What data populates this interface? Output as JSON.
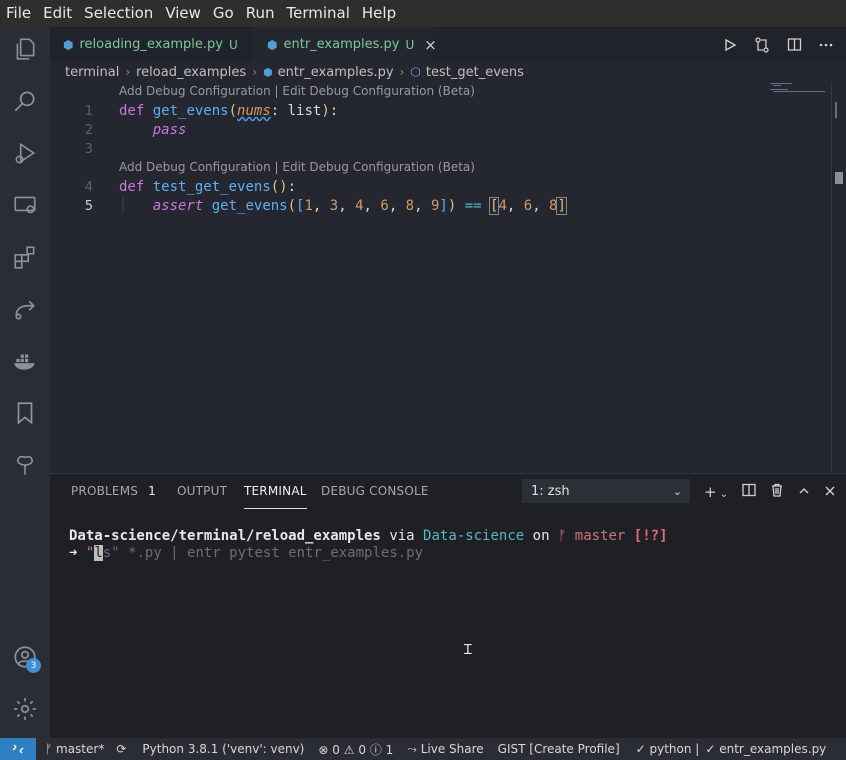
{
  "menu": [
    "File",
    "Edit",
    "Selection",
    "View",
    "Go",
    "Run",
    "Terminal",
    "Help"
  ],
  "activity_badge": "3",
  "tabs": [
    {
      "name": "reloading_example.py",
      "status": "U"
    },
    {
      "name": "entr_examples.py",
      "status": "U",
      "close": "×"
    }
  ],
  "breadcrumb": [
    "terminal",
    "reload_examples",
    "entr_examples.py",
    "test_get_evens"
  ],
  "codelens": "Add Debug Configuration | Edit Debug Configuration (Beta)",
  "code": {
    "line_numbers": [
      "1",
      "2",
      "3",
      "4",
      "5"
    ],
    "def": "def",
    "get_evens": "get_evens",
    "nums": "nums",
    "list": "list",
    "pass": "pass",
    "test_get_evens": "test_get_evens",
    "assert": "assert",
    "call_args": [
      "1",
      "3",
      "4",
      "6",
      "8",
      "9"
    ],
    "expected": [
      "4",
      "6",
      "8"
    ]
  },
  "panel": {
    "tabs": [
      "PROBLEMS",
      "OUTPUT",
      "TERMINAL",
      "DEBUG CONSOLE"
    ],
    "problems_count": "1",
    "terminal_select": "1: zsh"
  },
  "terminal": {
    "path": "Data-science/terminal/reload_examples",
    "via": "via",
    "env": "Data-science",
    "on": "on",
    "branch": "master",
    "git_status": "[!?]",
    "arrow": "➜",
    "typed_open": "\"",
    "typed_cursor": "l",
    "typed_rest": "s\"",
    "ghost": " *.py | entr pytest entr_examples.py"
  },
  "status": {
    "branch": "master*",
    "python": "Python 3.8.1 ('venv': venv)",
    "errors": "0",
    "warnings": "0",
    "info": "1",
    "live_share": "Live Share",
    "gist": "GIST [Create Profile]",
    "lang": "python |",
    "file": "entr_examples.py"
  }
}
